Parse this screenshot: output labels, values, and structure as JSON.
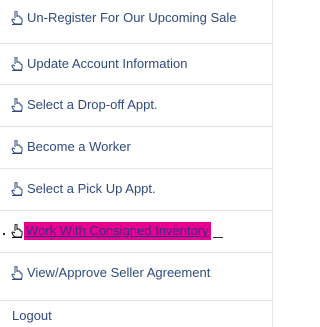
{
  "menu": {
    "items": [
      {
        "label": "Un-Register For Our Upcoming Sale",
        "icon": "hand-pointer-icon"
      },
      {
        "label": "Update Account Information",
        "icon": "hand-pointer-icon"
      },
      {
        "label": "Select a Drop-off Appt.",
        "icon": "hand-pointer-icon"
      },
      {
        "label": "Become a Worker",
        "icon": "hand-pointer-icon"
      },
      {
        "label": "Select a Pick Up Appt.",
        "icon": "hand-pointer-icon"
      },
      {
        "label": "Work With Consigned Inventory",
        "icon": "hand-pointer-icon",
        "highlighted": true,
        "highlight_color": "#e8008f"
      },
      {
        "label": "View/Approve Seller Agreement",
        "icon": "hand-pointer-icon"
      }
    ],
    "logout_label": "Logout"
  },
  "colors": {
    "link_text": "#2f4a7c",
    "divider": "#e3e3e3",
    "highlight": "#e8008f"
  }
}
